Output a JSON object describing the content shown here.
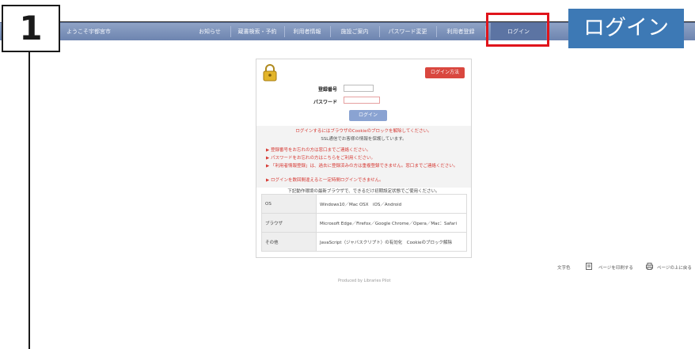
{
  "step": {
    "number": "1"
  },
  "callout": {
    "text": "ログイン"
  },
  "nav": {
    "welcome": "ようこそ宇都宮市",
    "items": [
      "お知らせ",
      "蔵書検索・予約",
      "利用者情報",
      "施設ご案内",
      "パスワード変更",
      "利用者登録",
      "ログイン"
    ]
  },
  "login": {
    "help_label": "ログイン方法",
    "id_label": "登録番号",
    "password_label": "パスワード",
    "button_label": "ログイン",
    "notice_red": "ログインするにはブラウザのCookieのブロックを解除してください。",
    "notice_ssl": "SSL通信でお客様の情報を保護しています。",
    "bullets": [
      "登録番号をお忘れの方は窓口までご連絡ください。",
      "パスワードをお忘れの方はこちらをご利用ください。",
      "「利用者情報登録」は、過去に登録済みの方は重複登録できません。窓口までご連絡ください。",
      "ログインを数回間違えると一定時間ログインできません。"
    ],
    "env_title": "下記動作環境の最新ブラウザで、できるだけ初期設定状態でご使用ください。",
    "env_rows": [
      {
        "head": "OS",
        "value": "Windows10／Mac OSX　iOS／Android"
      },
      {
        "head": "ブラウザ",
        "value": "Microsoft Edge／Firefox／Google Chrome／Opera／Mac：Safari"
      },
      {
        "head": "その他",
        "value": "JavaScript（ジャバスクリプト）の有効化　Cookieのブロック解除"
      }
    ]
  },
  "utility": {
    "text_size": "文字色",
    "print": "ページを印刷する",
    "top": "ページの上に戻る"
  },
  "footer": {
    "text": "Produced by Libraries Pilot"
  },
  "colors": {
    "nav": "#7a8fba",
    "callout": "#3d79b5",
    "highlight": "#e0141b",
    "danger": "#d9473f",
    "button": "#8aa3d2"
  }
}
